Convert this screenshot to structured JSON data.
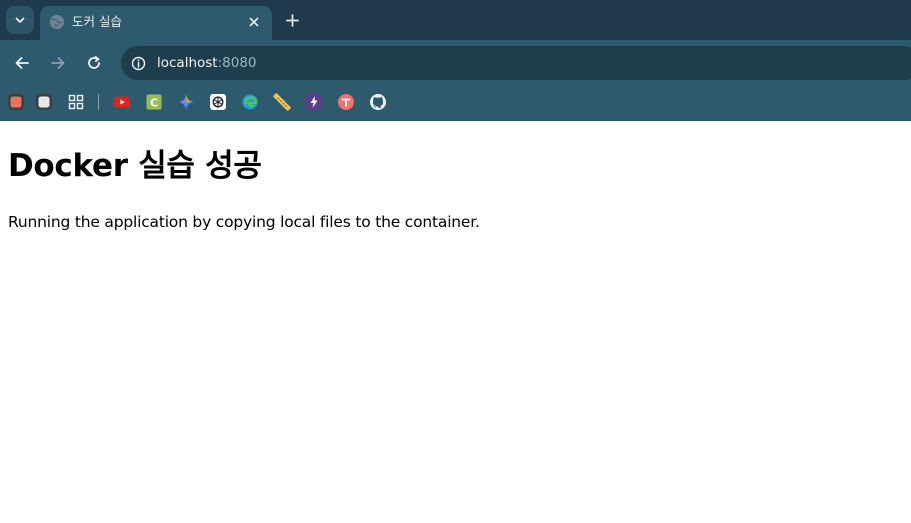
{
  "browser": {
    "tab": {
      "title": "도커 실습"
    },
    "address_bar": {
      "host": "localhost",
      "port": ":8080"
    },
    "colors": {
      "tabstrip": "#1e3a4c",
      "toolbar": "#2e5a6e",
      "omnibox": "#1e3d4d"
    },
    "bookmarks": [
      {
        "icon": "red-square-app-icon"
      },
      {
        "icon": "white-square-app-icon"
      },
      {
        "icon": "apps-grid-icon"
      },
      {
        "icon": "youtube-icon"
      },
      {
        "icon": "c-letter-icon"
      },
      {
        "icon": "gemini-sparkle-icon"
      },
      {
        "icon": "chatgpt-icon"
      },
      {
        "icon": "edge-icon"
      },
      {
        "icon": "ruler-icon"
      },
      {
        "icon": "lightning-icon"
      },
      {
        "icon": "t-badge-icon"
      },
      {
        "icon": "github-icon"
      }
    ]
  },
  "page": {
    "heading": "Docker 실습 성공",
    "paragraph": "Running the application by copying local files to the container."
  }
}
